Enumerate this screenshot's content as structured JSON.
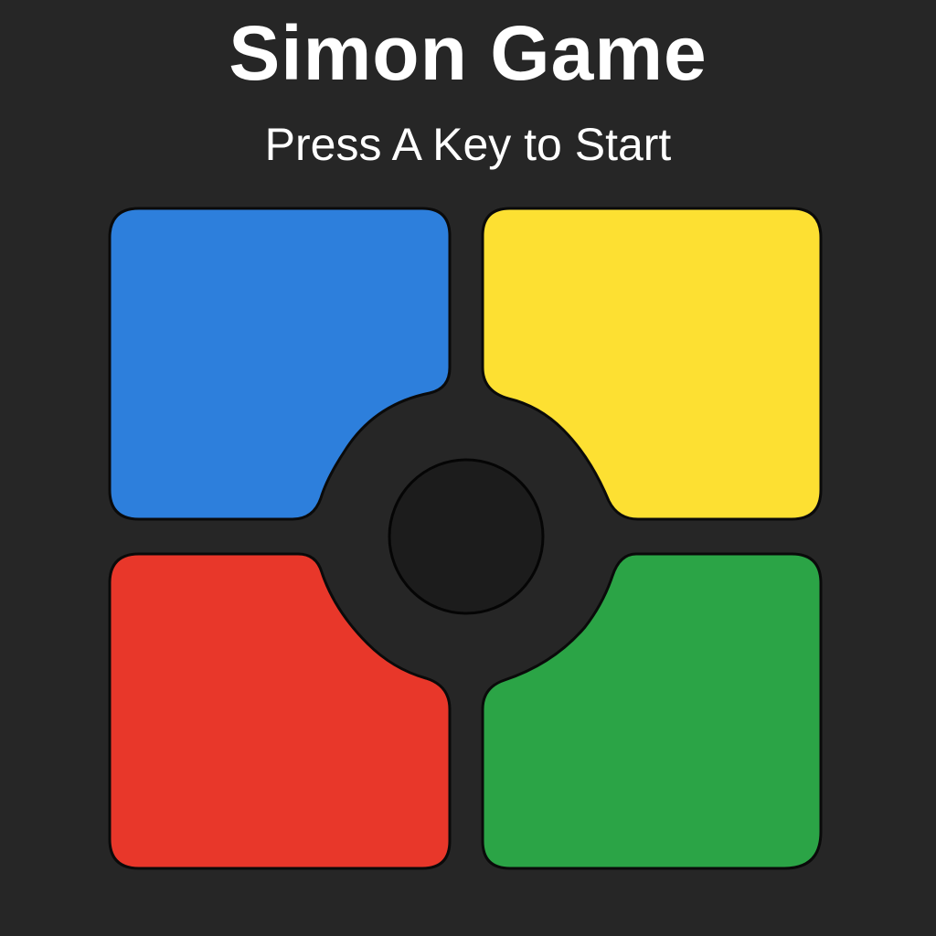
{
  "title": "Simon Game",
  "subtitle": "Press A Key to Start",
  "buttons": [
    {
      "id": "blue",
      "color": "#2d7fdc"
    },
    {
      "id": "yellow",
      "color": "#fde032"
    },
    {
      "id": "red",
      "color": "#e8372a"
    },
    {
      "id": "green",
      "color": "#2ba446"
    }
  ],
  "center_color": "#1c1c1c",
  "background_color": "#262626"
}
